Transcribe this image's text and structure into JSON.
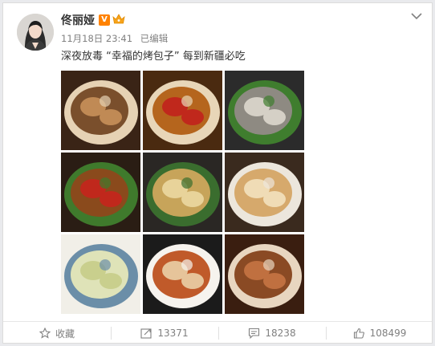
{
  "post": {
    "username": "佟丽娅",
    "verified_badge": "V",
    "time": "11月18日 23:41",
    "edited": "已编辑",
    "text": "深夜放毒 “幸福的烤包子” 每到新疆必吃"
  },
  "photos": [
    {
      "name": "photo-braised-meat",
      "colors": [
        "#3a2416",
        "#7a4f2c",
        "#c08a55",
        "#e6d2b4"
      ]
    },
    {
      "name": "photo-chili-chicken",
      "colors": [
        "#4a2a10",
        "#b5651d",
        "#c0281c",
        "#e8d6b8"
      ]
    },
    {
      "name": "photo-lamb-platter",
      "colors": [
        "#2b2b2b",
        "#8e8a82",
        "#d5d0c6",
        "#3f7d2e"
      ]
    },
    {
      "name": "photo-big-plate-chicken",
      "colors": [
        "#2a1d14",
        "#8a4a1c",
        "#c0281c",
        "#3f7a2c"
      ]
    },
    {
      "name": "photo-fried-noodles",
      "colors": [
        "#2a2724",
        "#c7a45a",
        "#e8d39a",
        "#3a6d2e"
      ]
    },
    {
      "name": "photo-baked-buns",
      "colors": [
        "#3a2a1e",
        "#d6a96c",
        "#f0dcb6",
        "#ece6dc"
      ]
    },
    {
      "name": "photo-green-grapes",
      "colors": [
        "#f1efe8",
        "#dfe3b8",
        "#c9cf8d",
        "#6b8ea8"
      ]
    },
    {
      "name": "photo-noodle-soup",
      "colors": [
        "#1b1b1b",
        "#c05a2a",
        "#e6c49a",
        "#f6f3ee"
      ]
    },
    {
      "name": "photo-lamb-skewers",
      "colors": [
        "#3a1e10",
        "#8a4a24",
        "#c07040",
        "#e8d6c0"
      ]
    }
  ],
  "actions": {
    "favorite_label": "收藏",
    "repost_count": "13371",
    "comment_count": "18238",
    "like_count": "108499"
  },
  "colors": {
    "badge_orange": "#ff8200",
    "text_gray": "#808080"
  }
}
